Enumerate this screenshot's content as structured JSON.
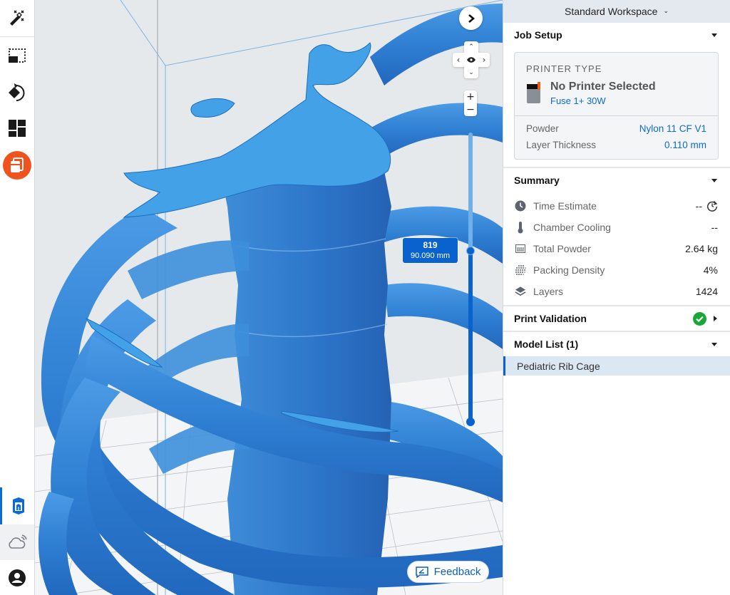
{
  "toolbar": {
    "top_tools": [
      {
        "name": "magic-wand-tool",
        "icon": "magic-wand-icon"
      },
      {
        "name": "select-box-tool",
        "icon": "selection-box-icon"
      },
      {
        "name": "rotate-tool",
        "icon": "rotate-icon"
      },
      {
        "name": "layout-tool",
        "icon": "layout-grid-icon"
      },
      {
        "name": "print-setup-tool",
        "icon": "print-tool-icon",
        "active": true
      }
    ],
    "bottom_tools": [
      {
        "name": "job-view-tool",
        "icon": "printer-3d-icon",
        "selected": true
      },
      {
        "name": "cloud-tool",
        "icon": "cloud-icon"
      },
      {
        "name": "account-tool",
        "icon": "user-account-icon"
      }
    ],
    "accent_color": "#f0541e"
  },
  "viewport": {
    "model_name": "Pediatric Rib Cage",
    "model_color": "#2f7fd3",
    "layer": {
      "number": "819",
      "height": "90.090 mm",
      "current_layer": 819,
      "total_layers": 1424
    },
    "controls": {
      "collapse_icon": "chevron-right-icon",
      "dpad_up": "⌃",
      "dpad_down": "⌄",
      "dpad_left": "‹",
      "dpad_right": "›",
      "zoom_in": "+",
      "zoom_out": "−"
    },
    "feedback_label": "Feedback"
  },
  "panel": {
    "workspace": "Standard Workspace",
    "job_setup": {
      "title": "Job Setup",
      "printer_type_label": "PRINTER TYPE",
      "printer_name": "No Printer Selected",
      "printer_model": "Fuse 1+ 30W",
      "powder_label": "Powder",
      "powder_value": "Nylon 11 CF V1",
      "layer_thickness_label": "Layer Thickness",
      "layer_thickness_value": "0.110 mm"
    },
    "summary": {
      "title": "Summary",
      "rows": [
        {
          "icon": "clock-icon",
          "label": "Time Estimate",
          "value": "--"
        },
        {
          "icon": "thermometer-icon",
          "label": "Chamber Cooling",
          "value": "--"
        },
        {
          "icon": "powder-icon",
          "label": "Total Powder",
          "value": "2.64 kg"
        },
        {
          "icon": "packing-dots-icon",
          "label": "Packing Density",
          "value": "4%"
        },
        {
          "icon": "layers-icon",
          "label": "Layers",
          "value": "1424"
        }
      ]
    },
    "print_validation": {
      "title": "Print Validation",
      "status": "valid",
      "status_color": "#1aa73a"
    },
    "model_list": {
      "title": "Model List (1)",
      "items": [
        "Pediatric Rib Cage"
      ]
    }
  }
}
